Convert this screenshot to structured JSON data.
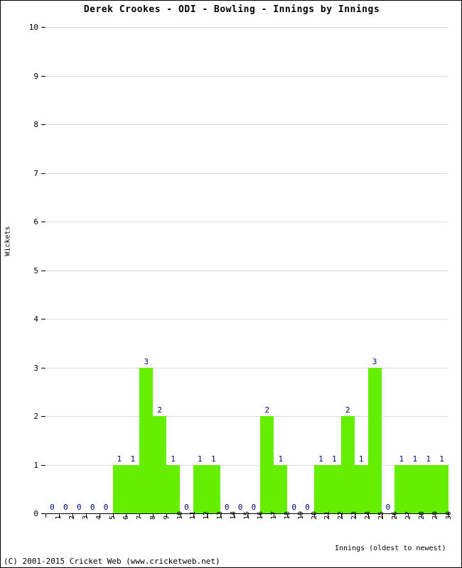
{
  "chart_data": {
    "type": "bar",
    "title": "Derek Crookes - ODI - Bowling - Innings by Innings",
    "xlabel": "Innings (oldest to newest)",
    "ylabel": "Wickets",
    "categories": [
      "1",
      "2",
      "3",
      "4",
      "5",
      "6",
      "7",
      "8",
      "9",
      "10",
      "11",
      "12",
      "13",
      "14",
      "15",
      "16",
      "17",
      "18",
      "19",
      "20",
      "21",
      "22",
      "23",
      "24",
      "25",
      "26",
      "27",
      "28",
      "29",
      "30"
    ],
    "values": [
      0,
      0,
      0,
      0,
      0,
      1,
      1,
      3,
      2,
      1,
      0,
      1,
      1,
      0,
      0,
      0,
      2,
      1,
      0,
      0,
      1,
      1,
      2,
      1,
      3,
      0,
      1,
      1,
      1,
      1
    ],
    "ylim": [
      0,
      10
    ],
    "yticks": [
      0,
      1,
      2,
      3,
      4,
      5,
      6,
      7,
      8,
      9,
      10
    ],
    "grid": true,
    "legend": false,
    "bar_color": "#66ee00",
    "data_label_color": "#000080",
    "axis_color": "#000000",
    "gridline_color": "#dcdcdc",
    "background_color": "#ffffff"
  },
  "footer": {
    "copyright": "(C) 2001-2015 Cricket Web (www.cricketweb.net)"
  }
}
